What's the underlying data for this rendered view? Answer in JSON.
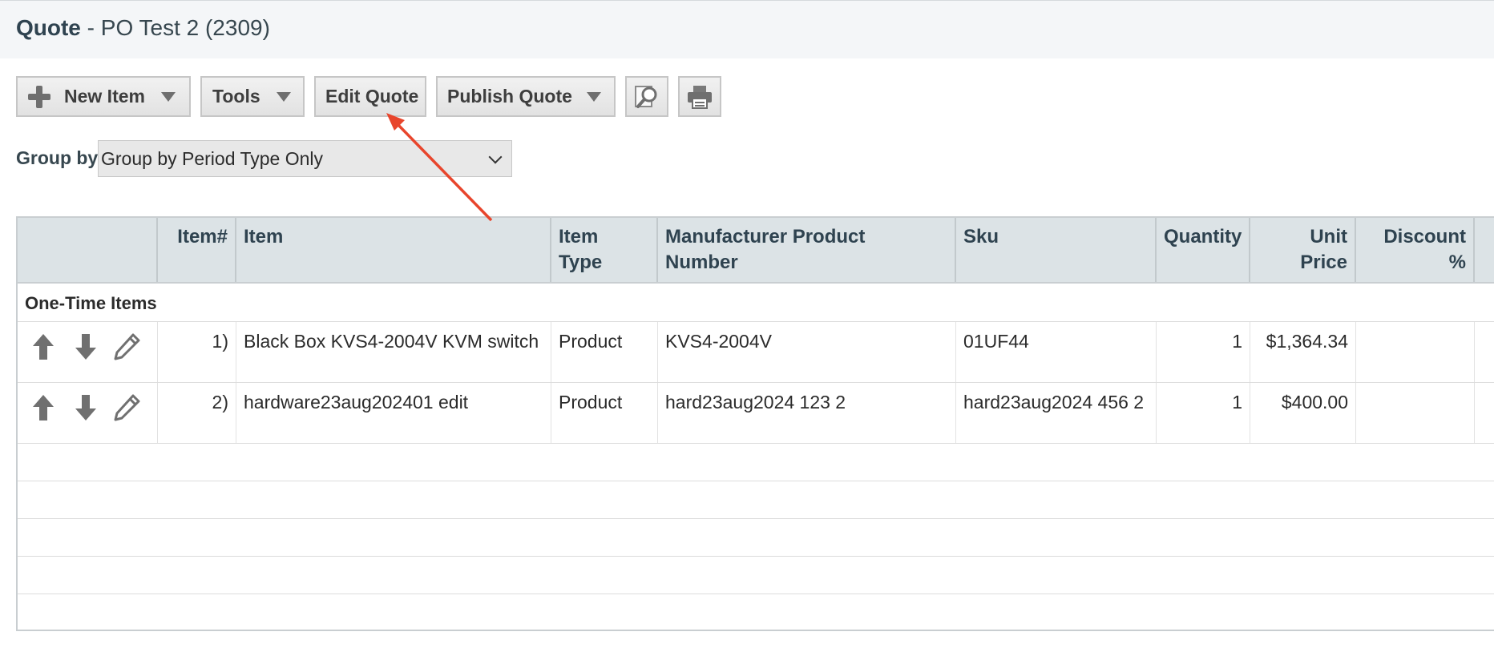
{
  "page": {
    "title_bold": "Quote",
    "title_rest": " - PO Test 2 (2309)"
  },
  "toolbar": {
    "new_item_label": "New Item",
    "tools_label": "Tools",
    "edit_quote_label": "Edit Quote",
    "publish_quote_label": "Publish Quote",
    "icons": [
      "plus-icon",
      "caret-down-icon",
      "preview-search-icon",
      "printer-icon"
    ]
  },
  "group_by": {
    "label": "Group by",
    "selected": "Group by Period Type Only"
  },
  "table": {
    "columns": {
      "item_num": "Item#",
      "item": "Item",
      "item_type_1": "Item",
      "item_type_2": "Type",
      "mpn_1": "Manufacturer Product",
      "mpn_2": "Number",
      "sku": "Sku",
      "quantity": "Quantity",
      "unit_price_1": "Unit",
      "unit_price_2": "Price",
      "discount_1": "Discount",
      "discount_2": "%"
    },
    "group_header": "One-Time Items",
    "rows": [
      {
        "num": "1)",
        "item": "Black Box KVS4-2004V KVM switch",
        "type": "Product",
        "mpn": "KVS4-2004V",
        "sku": "01UF44",
        "qty": "1",
        "unit_price": "$1,364.34",
        "discount": ""
      },
      {
        "num": "2)",
        "item": "hardware23aug202401 edit",
        "type": "Product",
        "mpn": "hard23aug2024 123 2",
        "sku": "hard23aug2024 456 2",
        "qty": "1",
        "unit_price": "$400.00",
        "discount": ""
      }
    ]
  },
  "colors": {
    "header_bg": "#dce3e6",
    "header_text": "#2f4350",
    "title_bg": "#f4f6f8",
    "annotation_arrow": "#e8452c"
  }
}
